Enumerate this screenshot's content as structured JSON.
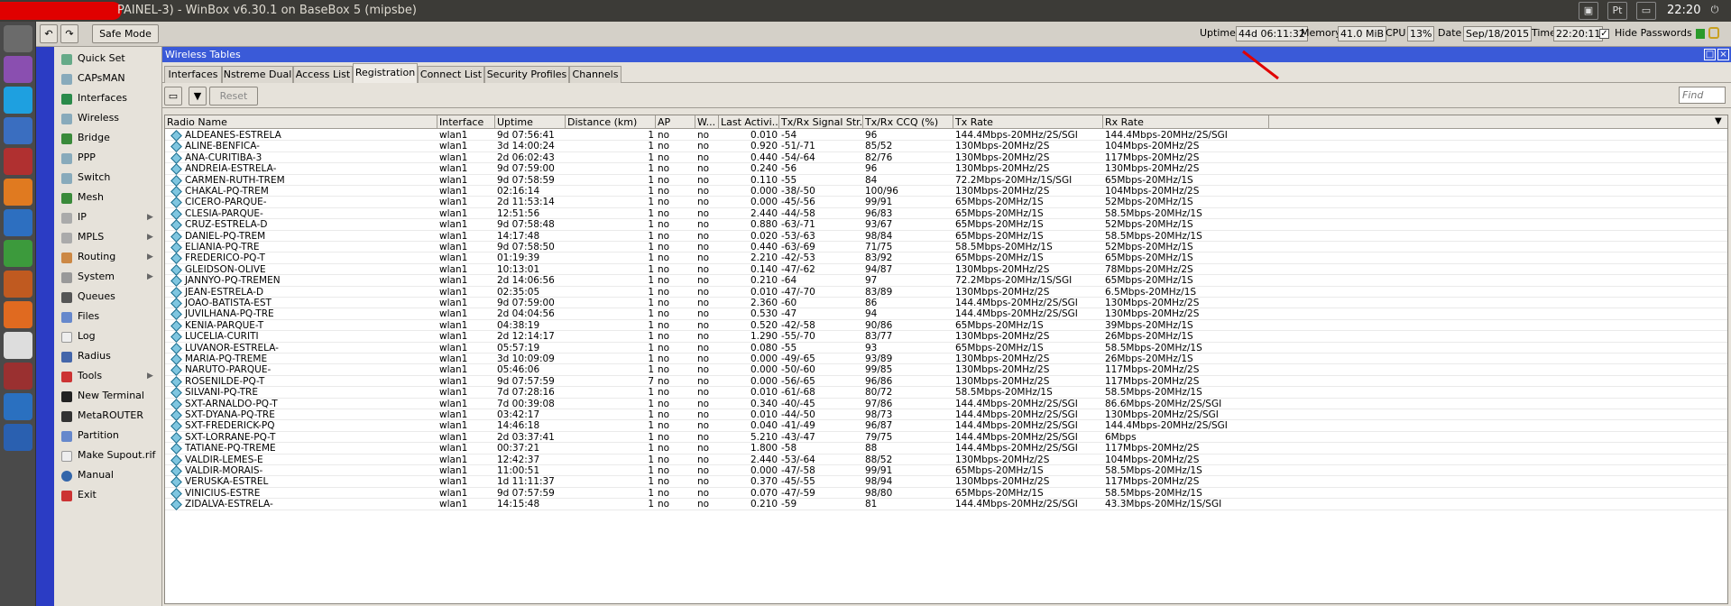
{
  "titlebar": {
    "title": "PAINEL-3) - WinBox v6.30.1 on BaseBox 5 (mipsbe)",
    "tray_pt": "Pt",
    "clock": "22:20"
  },
  "toolbar": {
    "safe_mode": "Safe Mode",
    "uptime_label": "Uptime",
    "uptime": "44d 06:11:32",
    "memory_label": "Memory",
    "memory": "41.0 MiB",
    "cpu_label": "CPU",
    "cpu": "13%",
    "date_label": "Date",
    "date": "Sep/18/2015",
    "time_label": "Time",
    "time": "22:20:11",
    "hide_passwords": "Hide Passwords"
  },
  "menu": [
    "Quick Set",
    "CAPsMAN",
    "Interfaces",
    "Wireless",
    "Bridge",
    "PPP",
    "Switch",
    "Mesh",
    "IP",
    "MPLS",
    "Routing",
    "System",
    "Queues",
    "Files",
    "Log",
    "Radius",
    "Tools",
    "New Terminal",
    "MetaROUTER",
    "Partition",
    "Make Supout.rif",
    "Manual",
    "Exit"
  ],
  "window": {
    "title": "Wireless Tables",
    "tabs": [
      "Interfaces",
      "Nstreme Dual",
      "Access List",
      "Registration",
      "Connect List",
      "Security Profiles",
      "Channels"
    ],
    "reset": "Reset",
    "find_placeholder": "Find"
  },
  "table": {
    "headers": [
      "Radio Name",
      "Interface",
      "Uptime",
      "Distance (km)",
      "AP",
      "W...",
      "Last Activi...",
      "Tx/Rx Signal Str...",
      "Tx/Rx CCQ (%)",
      "Tx Rate",
      "Rx Rate"
    ],
    "rows": [
      [
        "ALDEANES-ESTRELA",
        "wlan1",
        "9d 07:56:41",
        "1",
        "no",
        "no",
        "0.010",
        "-54",
        "96",
        "144.4Mbps-20MHz/2S/SGI",
        "144.4Mbps-20MHz/2S/SGI"
      ],
      [
        "ALINE-BENFICA-",
        "wlan1",
        "3d 14:00:24",
        "1",
        "no",
        "no",
        "0.920",
        "-51/-71",
        "85/52",
        "130Mbps-20MHz/2S",
        "104Mbps-20MHz/2S"
      ],
      [
        "ANA-CURITIBA-3",
        "wlan1",
        "2d 06:02:43",
        "1",
        "no",
        "no",
        "0.440",
        "-54/-64",
        "82/76",
        "130Mbps-20MHz/2S",
        "117Mbps-20MHz/2S"
      ],
      [
        "ANDREIA-ESTRELA-",
        "wlan1",
        "9d 07:59:00",
        "1",
        "no",
        "no",
        "0.240",
        "-56",
        "96",
        "130Mbps-20MHz/2S",
        "130Mbps-20MHz/2S"
      ],
      [
        "CARMEN-RUTH-TREM",
        "wlan1",
        "9d 07:58:59",
        "1",
        "no",
        "no",
        "0.110",
        "-55",
        "84",
        "72.2Mbps-20MHz/1S/SGI",
        "65Mbps-20MHz/1S"
      ],
      [
        "CHAKAL-PQ-TREM",
        "wlan1",
        "02:16:14",
        "1",
        "no",
        "no",
        "0.000",
        "-38/-50",
        "100/96",
        "130Mbps-20MHz/2S",
        "104Mbps-20MHz/2S"
      ],
      [
        "CICERO-PARQUE-",
        "wlan1",
        "2d 11:53:14",
        "1",
        "no",
        "no",
        "0.000",
        "-45/-56",
        "99/91",
        "65Mbps-20MHz/1S",
        "52Mbps-20MHz/1S"
      ],
      [
        "CLESIA-PARQUE-",
        "wlan1",
        "12:51:56",
        "1",
        "no",
        "no",
        "2.440",
        "-44/-58",
        "96/83",
        "65Mbps-20MHz/1S",
        "58.5Mbps-20MHz/1S"
      ],
      [
        "CRUZ-ESTRELA-D",
        "wlan1",
        "9d 07:58:48",
        "1",
        "no",
        "no",
        "0.880",
        "-63/-71",
        "93/67",
        "65Mbps-20MHz/1S",
        "52Mbps-20MHz/1S"
      ],
      [
        "DANIEL-PQ-TREM",
        "wlan1",
        "14:17:48",
        "1",
        "no",
        "no",
        "0.020",
        "-53/-63",
        "98/84",
        "65Mbps-20MHz/1S",
        "58.5Mbps-20MHz/1S"
      ],
      [
        "ELIANIA-PQ-TRE",
        "wlan1",
        "9d 07:58:50",
        "1",
        "no",
        "no",
        "0.440",
        "-63/-69",
        "71/75",
        "58.5Mbps-20MHz/1S",
        "52Mbps-20MHz/1S"
      ],
      [
        "FREDERICO-PQ-T",
        "wlan1",
        "01:19:39",
        "1",
        "no",
        "no",
        "2.210",
        "-42/-53",
        "83/92",
        "65Mbps-20MHz/1S",
        "65Mbps-20MHz/1S"
      ],
      [
        "GLEIDSON-OLIVE",
        "wlan1",
        "10:13:01",
        "1",
        "no",
        "no",
        "0.140",
        "-47/-62",
        "94/87",
        "130Mbps-20MHz/2S",
        "78Mbps-20MHz/2S"
      ],
      [
        "JANNYO-PQ-TREMEN",
        "wlan1",
        "2d 14:06:56",
        "1",
        "no",
        "no",
        "0.210",
        "-64",
        "97",
        "72.2Mbps-20MHz/1S/SGI",
        "65Mbps-20MHz/1S"
      ],
      [
        "JEAN-ESTRELA-D",
        "wlan1",
        "02:35:05",
        "1",
        "no",
        "no",
        "0.010",
        "-47/-70",
        "83/89",
        "130Mbps-20MHz/2S",
        "6.5Mbps-20MHz/1S"
      ],
      [
        "JOAO-BATISTA-EST",
        "wlan1",
        "9d 07:59:00",
        "1",
        "no",
        "no",
        "2.360",
        "-60",
        "86",
        "144.4Mbps-20MHz/2S/SGI",
        "130Mbps-20MHz/2S"
      ],
      [
        "JUVILHANA-PQ-TRE",
        "wlan1",
        "2d 04:04:56",
        "1",
        "no",
        "no",
        "0.530",
        "-47",
        "94",
        "144.4Mbps-20MHz/2S/SGI",
        "130Mbps-20MHz/2S"
      ],
      [
        "KENIA-PARQUE-T",
        "wlan1",
        "04:38:19",
        "1",
        "no",
        "no",
        "0.520",
        "-42/-58",
        "90/86",
        "65Mbps-20MHz/1S",
        "39Mbps-20MHz/1S"
      ],
      [
        "LUCELIA-CURITI",
        "wlan1",
        "2d 12:14:17",
        "1",
        "no",
        "no",
        "1.290",
        "-55/-70",
        "83/77",
        "130Mbps-20MHz/2S",
        "26Mbps-20MHz/1S"
      ],
      [
        "LUVANOR-ESTRELA-",
        "wlan1",
        "05:57:19",
        "1",
        "no",
        "no",
        "0.080",
        "-55",
        "93",
        "65Mbps-20MHz/1S",
        "58.5Mbps-20MHz/1S"
      ],
      [
        "MARIA-PQ-TREME",
        "wlan1",
        "3d 10:09:09",
        "1",
        "no",
        "no",
        "0.000",
        "-49/-65",
        "93/89",
        "130Mbps-20MHz/2S",
        "26Mbps-20MHz/1S"
      ],
      [
        "NARUTO-PARQUE-",
        "wlan1",
        "05:46:06",
        "1",
        "no",
        "no",
        "0.000",
        "-50/-60",
        "99/85",
        "130Mbps-20MHz/2S",
        "117Mbps-20MHz/2S"
      ],
      [
        "ROSENILDE-PQ-T",
        "wlan1",
        "9d 07:57:59",
        "7",
        "no",
        "no",
        "0.000",
        "-56/-65",
        "96/86",
        "130Mbps-20MHz/2S",
        "117Mbps-20MHz/2S"
      ],
      [
        "SILVANI-PQ-TRE",
        "wlan1",
        "7d 07:28:16",
        "1",
        "no",
        "no",
        "0.010",
        "-61/-68",
        "80/72",
        "58.5Mbps-20MHz/1S",
        "58.5Mbps-20MHz/1S"
      ],
      [
        "SXT-ARNALDO-PQ-T",
        "wlan1",
        "7d 00:39:08",
        "1",
        "no",
        "no",
        "0.340",
        "-40/-45",
        "97/86",
        "144.4Mbps-20MHz/2S/SGI",
        "86.6Mbps-20MHz/2S/SGI"
      ],
      [
        "SXT-DYANA-PQ-TRE",
        "wlan1",
        "03:42:17",
        "1",
        "no",
        "no",
        "0.010",
        "-44/-50",
        "98/73",
        "144.4Mbps-20MHz/2S/SGI",
        "130Mbps-20MHz/2S/SGI"
      ],
      [
        "SXT-FREDERICK-PQ",
        "wlan1",
        "14:46:18",
        "1",
        "no",
        "no",
        "0.040",
        "-41/-49",
        "96/87",
        "144.4Mbps-20MHz/2S/SGI",
        "144.4Mbps-20MHz/2S/SGI"
      ],
      [
        "SXT-LORRANE-PQ-T",
        "wlan1",
        "2d 03:37:41",
        "1",
        "no",
        "no",
        "5.210",
        "-43/-47",
        "79/75",
        "144.4Mbps-20MHz/2S/SGI",
        "6Mbps"
      ],
      [
        "TATIANE-PQ-TREME",
        "wlan1",
        "00:37:21",
        "1",
        "no",
        "no",
        "1.800",
        "-58",
        "88",
        "144.4Mbps-20MHz/2S/SGI",
        "117Mbps-20MHz/2S"
      ],
      [
        "VALDIR-LEMES-E",
        "wlan1",
        "12:42:37",
        "1",
        "no",
        "no",
        "2.440",
        "-53/-64",
        "88/52",
        "130Mbps-20MHz/2S",
        "104Mbps-20MHz/2S"
      ],
      [
        "VALDIR-MORAIS-",
        "wlan1",
        "11:00:51",
        "1",
        "no",
        "no",
        "0.000",
        "-47/-58",
        "99/91",
        "65Mbps-20MHz/1S",
        "58.5Mbps-20MHz/1S"
      ],
      [
        "VERUSKA-ESTREL",
        "wlan1",
        "1d 11:11:37",
        "1",
        "no",
        "no",
        "0.370",
        "-45/-55",
        "98/94",
        "130Mbps-20MHz/2S",
        "117Mbps-20MHz/2S"
      ],
      [
        "VINICIUS-ESTRE",
        "wlan1",
        "9d 07:57:59",
        "1",
        "no",
        "no",
        "0.070",
        "-47/-59",
        "98/80",
        "65Mbps-20MHz/1S",
        "58.5Mbps-20MHz/1S"
      ],
      [
        "ZIDALVA-ESTRELA-",
        "wlan1",
        "14:15:48",
        "1",
        "no",
        "no",
        "0.210",
        "-59",
        "81",
        "144.4Mbps-20MHz/2S/SGI",
        "43.3Mbps-20MHz/1S/SGI"
      ]
    ]
  }
}
